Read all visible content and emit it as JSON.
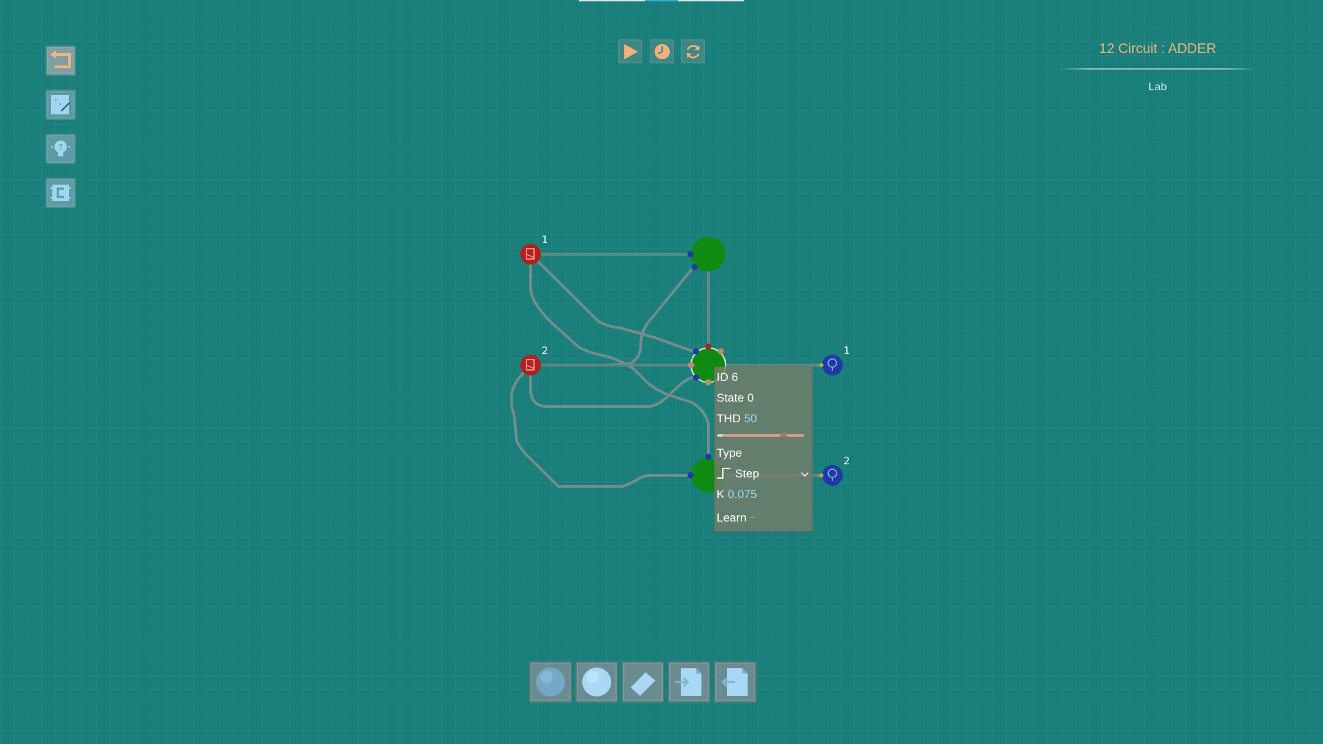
{
  "header": {
    "title": "12 Circuit : ADDER",
    "subtitle": "Lab"
  },
  "left_toolbar": [
    {
      "name": "back",
      "icon": "back-arrow-icon"
    },
    {
      "name": "edit",
      "icon": "edit-board-icon"
    },
    {
      "name": "hint",
      "icon": "lightbulb-icon"
    },
    {
      "name": "chip",
      "icon": "chip-icon"
    }
  ],
  "top_toolbar": [
    {
      "name": "play",
      "icon": "play-icon"
    },
    {
      "name": "step",
      "icon": "timer-icon"
    },
    {
      "name": "reset",
      "icon": "refresh-icon"
    }
  ],
  "nodes": {
    "input_1_label": "1",
    "input_2_label": "2",
    "output_1_label": "1",
    "output_2_label": "2"
  },
  "inspector": {
    "id_label": "ID",
    "id_value": "6",
    "state_label": "State",
    "state_value": "0",
    "thd_label": "THD",
    "thd_value": "50",
    "thd_fraction": 0.76,
    "type_label": "Type",
    "type_value": "Step",
    "k_label": "K",
    "k_value": "0.075",
    "learn_label": "Learn",
    "learn_value": "–"
  },
  "bottom_toolbar": [
    {
      "name": "neuron",
      "icon": "sphere-dark-icon"
    },
    {
      "name": "neuron-light",
      "icon": "sphere-light-icon"
    },
    {
      "name": "eraser",
      "icon": "eraser-icon"
    },
    {
      "name": "import",
      "icon": "document-import-icon"
    },
    {
      "name": "export",
      "icon": "document-export-icon"
    }
  ],
  "colors": {
    "background": "#1a7f7a",
    "title": "#f2b27e",
    "input_node": "#b3201e",
    "neuron": "#118a12",
    "output_node": "#1d3aa8",
    "wire": "#7a8f8d"
  }
}
